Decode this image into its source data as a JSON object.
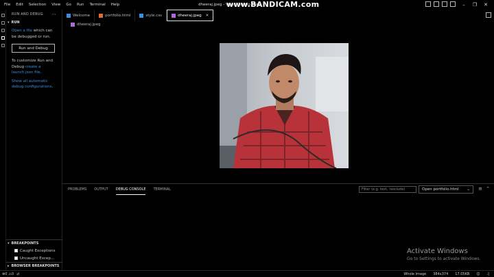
{
  "menu": [
    "File",
    "Edit",
    "Selection",
    "View",
    "Go",
    "Run",
    "Terminal",
    "Help"
  ],
  "window_title": "dheeraj.jpeg - Visual Studio Code",
  "watermark_brand": "www.BANDICAM.com",
  "sidebar": {
    "title": "RUN AND DEBUG",
    "run_section": "RUN",
    "open_file_link": "Open a file",
    "open_file_rest": " which can be debugged or run.",
    "run_debug_button": "Run and Debug",
    "customize_text": "To customize Run and Debug ",
    "create_link": "create a launch.json file",
    "show_all_link": "Show all automatic debug configurations",
    "breakpoints_title": "BREAKPOINTS",
    "breakpoints": [
      "Caught Exceptions",
      "Uncaught Excep..."
    ],
    "browser_breakpoints_title": "BROWSER BREAKPOINTS"
  },
  "tabs": [
    {
      "label": "Welcome",
      "icon_color": "#3a8fe0"
    },
    {
      "label": "portfolio.html",
      "icon_color": "#e06c3a"
    },
    {
      "label": "style.css",
      "icon_color": "#3a8fe0"
    },
    {
      "label": "dheeraj.jpeg",
      "icon_color": "#b06ad6",
      "active": true
    }
  ],
  "breadcrumb": "dheeraj.jpeg",
  "panel": {
    "tabs": [
      "PROBLEMS",
      "OUTPUT",
      "DEBUG CONSOLE",
      "TERMINAL"
    ],
    "active_tab": "DEBUG CONSOLE",
    "filter_placeholder": "Filter (e.g. text, !exclude)",
    "select_value": "Open portfolio.html"
  },
  "activate_windows": {
    "title": "Activate Windows",
    "subtitle": "Go to Settings to activate Windows."
  },
  "statusbar": {
    "errors": "0",
    "warnings": "0",
    "image_mode": "Whole Image",
    "dimensions": "384x374",
    "file_size": "17.05KB"
  }
}
